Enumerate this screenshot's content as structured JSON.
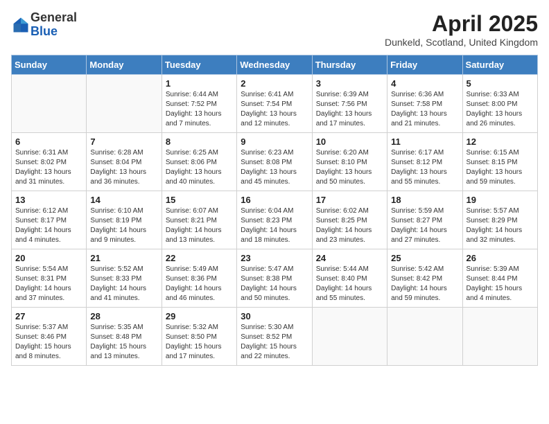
{
  "header": {
    "logo_general": "General",
    "logo_blue": "Blue",
    "title": "April 2025",
    "subtitle": "Dunkeld, Scotland, United Kingdom"
  },
  "weekdays": [
    "Sunday",
    "Monday",
    "Tuesday",
    "Wednesday",
    "Thursday",
    "Friday",
    "Saturday"
  ],
  "weeks": [
    [
      {
        "day": "",
        "info": ""
      },
      {
        "day": "",
        "info": ""
      },
      {
        "day": "1",
        "info": "Sunrise: 6:44 AM\nSunset: 7:52 PM\nDaylight: 13 hours and 7 minutes."
      },
      {
        "day": "2",
        "info": "Sunrise: 6:41 AM\nSunset: 7:54 PM\nDaylight: 13 hours and 12 minutes."
      },
      {
        "day": "3",
        "info": "Sunrise: 6:39 AM\nSunset: 7:56 PM\nDaylight: 13 hours and 17 minutes."
      },
      {
        "day": "4",
        "info": "Sunrise: 6:36 AM\nSunset: 7:58 PM\nDaylight: 13 hours and 21 minutes."
      },
      {
        "day": "5",
        "info": "Sunrise: 6:33 AM\nSunset: 8:00 PM\nDaylight: 13 hours and 26 minutes."
      }
    ],
    [
      {
        "day": "6",
        "info": "Sunrise: 6:31 AM\nSunset: 8:02 PM\nDaylight: 13 hours and 31 minutes."
      },
      {
        "day": "7",
        "info": "Sunrise: 6:28 AM\nSunset: 8:04 PM\nDaylight: 13 hours and 36 minutes."
      },
      {
        "day": "8",
        "info": "Sunrise: 6:25 AM\nSunset: 8:06 PM\nDaylight: 13 hours and 40 minutes."
      },
      {
        "day": "9",
        "info": "Sunrise: 6:23 AM\nSunset: 8:08 PM\nDaylight: 13 hours and 45 minutes."
      },
      {
        "day": "10",
        "info": "Sunrise: 6:20 AM\nSunset: 8:10 PM\nDaylight: 13 hours and 50 minutes."
      },
      {
        "day": "11",
        "info": "Sunrise: 6:17 AM\nSunset: 8:12 PM\nDaylight: 13 hours and 55 minutes."
      },
      {
        "day": "12",
        "info": "Sunrise: 6:15 AM\nSunset: 8:15 PM\nDaylight: 13 hours and 59 minutes."
      }
    ],
    [
      {
        "day": "13",
        "info": "Sunrise: 6:12 AM\nSunset: 8:17 PM\nDaylight: 14 hours and 4 minutes."
      },
      {
        "day": "14",
        "info": "Sunrise: 6:10 AM\nSunset: 8:19 PM\nDaylight: 14 hours and 9 minutes."
      },
      {
        "day": "15",
        "info": "Sunrise: 6:07 AM\nSunset: 8:21 PM\nDaylight: 14 hours and 13 minutes."
      },
      {
        "day": "16",
        "info": "Sunrise: 6:04 AM\nSunset: 8:23 PM\nDaylight: 14 hours and 18 minutes."
      },
      {
        "day": "17",
        "info": "Sunrise: 6:02 AM\nSunset: 8:25 PM\nDaylight: 14 hours and 23 minutes."
      },
      {
        "day": "18",
        "info": "Sunrise: 5:59 AM\nSunset: 8:27 PM\nDaylight: 14 hours and 27 minutes."
      },
      {
        "day": "19",
        "info": "Sunrise: 5:57 AM\nSunset: 8:29 PM\nDaylight: 14 hours and 32 minutes."
      }
    ],
    [
      {
        "day": "20",
        "info": "Sunrise: 5:54 AM\nSunset: 8:31 PM\nDaylight: 14 hours and 37 minutes."
      },
      {
        "day": "21",
        "info": "Sunrise: 5:52 AM\nSunset: 8:33 PM\nDaylight: 14 hours and 41 minutes."
      },
      {
        "day": "22",
        "info": "Sunrise: 5:49 AM\nSunset: 8:36 PM\nDaylight: 14 hours and 46 minutes."
      },
      {
        "day": "23",
        "info": "Sunrise: 5:47 AM\nSunset: 8:38 PM\nDaylight: 14 hours and 50 minutes."
      },
      {
        "day": "24",
        "info": "Sunrise: 5:44 AM\nSunset: 8:40 PM\nDaylight: 14 hours and 55 minutes."
      },
      {
        "day": "25",
        "info": "Sunrise: 5:42 AM\nSunset: 8:42 PM\nDaylight: 14 hours and 59 minutes."
      },
      {
        "day": "26",
        "info": "Sunrise: 5:39 AM\nSunset: 8:44 PM\nDaylight: 15 hours and 4 minutes."
      }
    ],
    [
      {
        "day": "27",
        "info": "Sunrise: 5:37 AM\nSunset: 8:46 PM\nDaylight: 15 hours and 8 minutes."
      },
      {
        "day": "28",
        "info": "Sunrise: 5:35 AM\nSunset: 8:48 PM\nDaylight: 15 hours and 13 minutes."
      },
      {
        "day": "29",
        "info": "Sunrise: 5:32 AM\nSunset: 8:50 PM\nDaylight: 15 hours and 17 minutes."
      },
      {
        "day": "30",
        "info": "Sunrise: 5:30 AM\nSunset: 8:52 PM\nDaylight: 15 hours and 22 minutes."
      },
      {
        "day": "",
        "info": ""
      },
      {
        "day": "",
        "info": ""
      },
      {
        "day": "",
        "info": ""
      }
    ]
  ]
}
